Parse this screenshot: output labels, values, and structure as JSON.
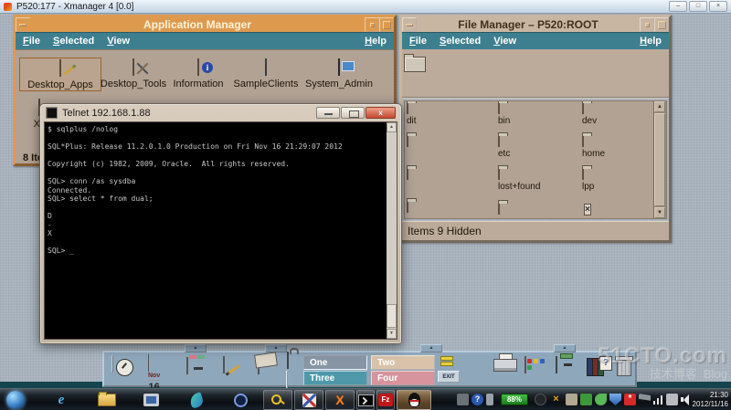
{
  "xmanager": {
    "title": "P520:177 - Xmanager 4 [0.0]"
  },
  "app_manager": {
    "title": "Application Manager",
    "menus": [
      "File",
      "Selected",
      "View"
    ],
    "help_menu": "Help",
    "icons": [
      {
        "label": "Desktop_Apps"
      },
      {
        "label": "Desktop_Tools"
      },
      {
        "label": "Information"
      },
      {
        "label": "SampleClients"
      },
      {
        "label": "System_Admin"
      }
    ],
    "info_glyph": "i",
    "partial_icon_label": "Xc",
    "status": "8 Items"
  },
  "file_manager": {
    "title": "File Manager – P520:ROOT",
    "menus": [
      "File",
      "Selected",
      "View"
    ],
    "help_menu": "Help",
    "folders": {
      "col1": [
        "dit",
        "",
        "",
        ""
      ],
      "col2": [
        "bin",
        "etc",
        "lost+found",
        ""
      ],
      "col3": [
        "dev",
        "home",
        "lpp"
      ]
    },
    "exec_glyph": "×",
    "status": "Items 9 Hidden"
  },
  "telnet": {
    "title": "Telnet 192.168.1.88",
    "close_glyph": "x",
    "terminal_text": "$ sqlplus /nolog\n\nSQL*Plus: Release 11.2.0.1.0 Production on Fri Nov 16 21:29:07 2012\n\nCopyright (c) 1982, 2009, Oracle.  All rights reserved.\n\nSQL> conn /as sysdba\nConnected.\nSQL> select * from dual;\n\nD\n-\nX\n\nSQL> _"
  },
  "front_panel": {
    "calendar": {
      "month": "Nov",
      "day": "16"
    },
    "workspaces": [
      "One",
      "Two",
      "Three",
      "Four"
    ],
    "exit_label": "EXIT",
    "help_glyph": "?",
    "tab_glyph": "▲"
  },
  "watermark": {
    "brand": "51CTO.com",
    "subtitle_cn": "技术博客",
    "subtitle_en": "Blog"
  },
  "taskbar": {
    "ie_glyph": "e",
    "xmanager_glyph": "X",
    "filezilla_glyph": "Fz",
    "tray_x_glyph": "×",
    "tray_flower_glyph": "*",
    "tray": {
      "battery": "88%",
      "time": "21:30",
      "date": "2012/11/16"
    }
  },
  "colors": {
    "cde_active_title": "#dd9a4f",
    "cde_menu_bar": "#3d7f8f",
    "cde_surface": "#b1a294",
    "cde_inactive_title": "#c9b6a2",
    "desktop_backdrop": "#a9b3bd",
    "front_panel_blue": "#8fa7bb",
    "workspace_one": "#8795a5",
    "workspace_two": "#d9c2a9",
    "workspace_three": "#4e98a9",
    "workspace_four": "#d6949c",
    "terminal_bg": "#000000",
    "terminal_fg": "#c8c8c8"
  }
}
